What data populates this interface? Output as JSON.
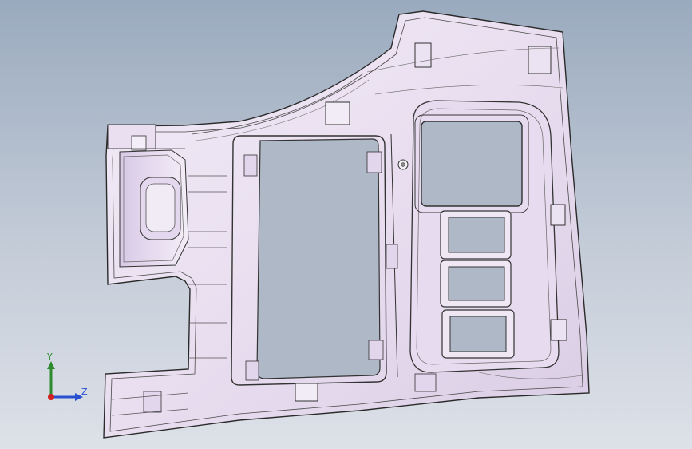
{
  "viewport": {
    "background_top": "#9aaabe",
    "background_bottom": "#dde1e8",
    "part_fill": "#ece3f1",
    "part_stroke": "#2a2a2a"
  },
  "triad": {
    "y_label": "Y",
    "z_label": "Z",
    "y_color": "#2f8a2f",
    "z_color": "#2a4fcf",
    "x_color": "#d42020"
  }
}
